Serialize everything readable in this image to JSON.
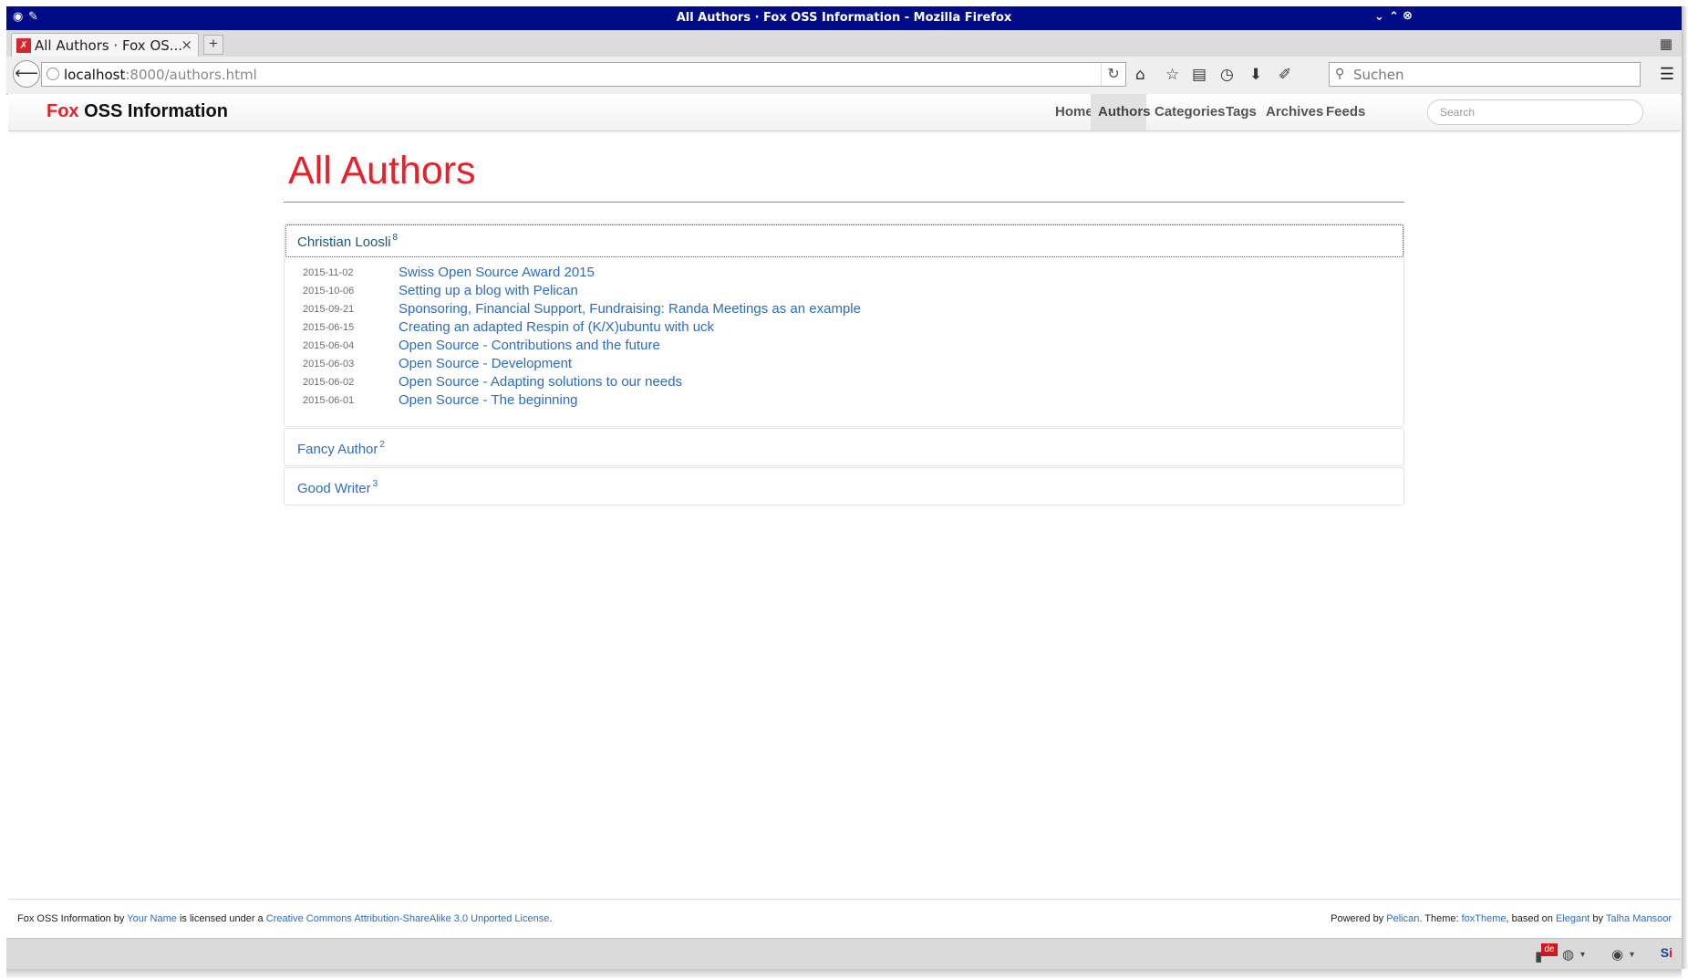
{
  "window": {
    "title": "All Authors · Fox OSS Information - Mozilla Firefox",
    "icons": [
      "firefox-icon",
      "pin-icon",
      "minimize-icon",
      "maximize-icon",
      "close-icon"
    ]
  },
  "tabs": [
    {
      "label": "All Authors · Fox OS...",
      "close": "×",
      "favicon": "fox-favicon"
    }
  ],
  "newtab_label": "+",
  "navbar": {
    "url_host": "localhost",
    "url_rest": ":8000/authors.html",
    "search_placeholder": "Suchen",
    "toolbar_icons": [
      "home-icon",
      "bookmark-star-icon",
      "reader-icon",
      "history-icon",
      "download-icon",
      "developer-wrench-icon"
    ]
  },
  "site": {
    "brand_red": "Fox",
    "brand_rest": "OSS Information",
    "nav": [
      "Home",
      "Authors",
      "Categories",
      "Tags",
      "Archives",
      "Feeds"
    ],
    "active_nav": "Authors",
    "search_placeholder": "Search"
  },
  "page": {
    "title": "All Authors"
  },
  "authors": [
    {
      "name": "Christian Loosli",
      "count": "8",
      "expanded": true,
      "articles": [
        {
          "date": "2015-11-02",
          "title": "Swiss Open Source Award 2015"
        },
        {
          "date": "2015-10-06",
          "title": "Setting up a blog with Pelican"
        },
        {
          "date": "2015-09-21",
          "title": "Sponsoring, Financial Support, Fundraising: Randa Meetings as an example"
        },
        {
          "date": "2015-06-15",
          "title": "Creating an adapted Respin of (K/X)ubuntu with uck"
        },
        {
          "date": "2015-06-04",
          "title": "Open Source - Contributions and the future"
        },
        {
          "date": "2015-06-03",
          "title": "Open Source - Development"
        },
        {
          "date": "2015-06-02",
          "title": "Open Source - Adapting solutions to our needs"
        },
        {
          "date": "2015-06-01",
          "title": "Open Source - The beginning"
        }
      ]
    },
    {
      "name": "Fancy Author",
      "count": "2",
      "expanded": false,
      "articles": []
    },
    {
      "name": "Good Writer",
      "count": "3",
      "expanded": false,
      "articles": []
    }
  ],
  "footer": {
    "site_name": "Fox OSS Information",
    "by": "by",
    "your_name": "Your Name",
    "licensed": "is licensed under a",
    "license": "Creative Commons Attribution-ShareAlike 3.0 Unported License",
    "period": ".",
    "powered_by": "Powered by",
    "pelican": "Pelican",
    "theme": ". Theme:",
    "foxtheme": "foxTheme",
    "based_on": ", based on",
    "elegant": "Elegant",
    "by2": "by",
    "talha": "Talha Mansoor"
  },
  "statusbar": {
    "lang_badge": "de",
    "si_label_a": "S",
    "si_label_b": "i"
  },
  "colors": {
    "brand_red": "#e8202a",
    "link_blue": "#2d6cc0",
    "titlebar_blue": "#000c87"
  }
}
